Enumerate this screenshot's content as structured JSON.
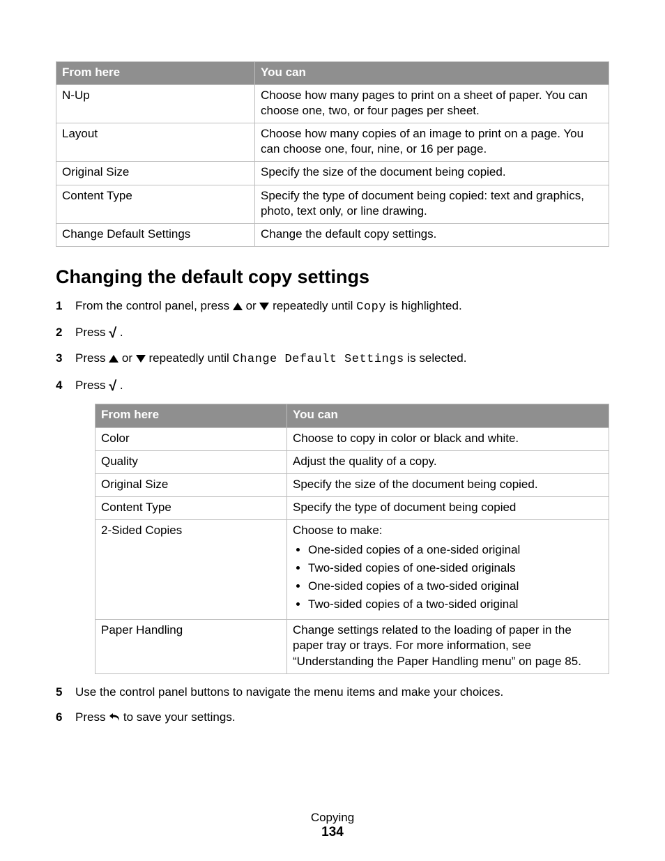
{
  "table1": {
    "headers": [
      "From here",
      "You can"
    ],
    "rows": [
      {
        "from": "N-Up",
        "you_can": "Choose how many pages to print on a sheet of paper. You can choose one, two, or four pages per sheet."
      },
      {
        "from": "Layout",
        "you_can": "Choose how many copies of an image to print on a page. You can choose one, four, nine, or 16 per page."
      },
      {
        "from": "Original Size",
        "you_can": "Specify the size of the document being copied."
      },
      {
        "from": "Content Type",
        "you_can": "Specify the type of document being copied: text and graphics, photo, text only, or line drawing."
      },
      {
        "from": "Change Default Settings",
        "you_can": "Change the default copy settings."
      }
    ]
  },
  "section_heading": "Changing the default copy settings",
  "steps": {
    "s1": {
      "pre": "From the control panel, press ",
      "or": " or ",
      "post": " repeatedly until ",
      "code": "Copy",
      "tail": " is highlighted."
    },
    "s2": {
      "pre": "Press ",
      "tail": "."
    },
    "s3": {
      "pre": "Press ",
      "or": " or ",
      "post": " repeatedly until ",
      "code": "Change Default Settings",
      "tail": " is selected."
    },
    "s4": {
      "pre": "Press ",
      "tail": "."
    },
    "s5": "Use the control panel buttons to navigate the menu items and make your choices.",
    "s6": {
      "pre": "Press ",
      "tail": " to save your settings."
    }
  },
  "table2": {
    "headers": [
      "From here",
      "You can"
    ],
    "rows": [
      {
        "from": "Color",
        "you_can": "Choose to copy in color or black and white."
      },
      {
        "from": "Quality",
        "you_can": "Adjust the quality of a copy."
      },
      {
        "from": "Original Size",
        "you_can": "Specify the size of the document being copied."
      },
      {
        "from": "Content Type",
        "you_can": "Specify the type of document being copied"
      },
      {
        "from": "2-Sided Copies",
        "lead": "Choose to make:",
        "items": [
          "One-sided copies of a one-sided original",
          "Two-sided copies of one-sided originals",
          "One-sided copies of a two-sided original",
          "Two-sided copies of a two-sided original"
        ]
      },
      {
        "from": "Paper Handling",
        "you_can": "Change settings related to the loading of paper in the paper tray or trays. For more information, see “Understanding the Paper Handling menu” on page 85."
      }
    ]
  },
  "footer": {
    "section": "Copying",
    "page": "134"
  }
}
